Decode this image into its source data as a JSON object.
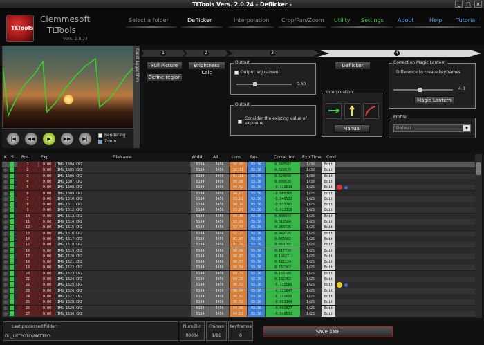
{
  "window": {
    "title": "TLTools Vers. 2.0.24 - Deflicker -",
    "min": "_",
    "max": "□",
    "close": "×"
  },
  "branding": {
    "company": "Ciemmesoft",
    "product": "TLTools",
    "version": "Vers. 2.0.24",
    "logo_text": "TLTools"
  },
  "nav": {
    "select_folder": "Select a folder",
    "deflicker": "Deflicker",
    "interpolation": "Interpolation",
    "crop": "Crop/Pan/Zoom",
    "utility": "Utility",
    "settings": "Settings",
    "about": "About",
    "help": "Help",
    "tutorial": "Tutorial"
  },
  "video": {
    "side_tab": "Crest Logarithm",
    "rendering_label": "Rendering",
    "zoom_label": "Zoom",
    "rendering_checked": false,
    "zoom_checked": true
  },
  "steps": {
    "s1": "1",
    "s2": "2",
    "s3": "3",
    "s4": "4"
  },
  "step1": {
    "full_picture": "Full Picture",
    "define_region": "Define region"
  },
  "step2": {
    "brightness_calc": "Brightness Calc"
  },
  "step3": {
    "output_title": "Output",
    "output_adjustment": "Output adjustment",
    "slider_value": "0.60",
    "slider_fraction": 0.3,
    "output2_title": "Output",
    "consider_text": "Consider the existing value of exposure",
    "interp_title": "Interpolation",
    "manual": "Manual"
  },
  "step4": {
    "deflicker": "Deflicker",
    "magic_title": "Correction Magic Lantern",
    "difference_text": "Difference to create keyframes",
    "slider_value": "4.0",
    "slider_fraction": 0.42,
    "magic_button": "Magic Lantern",
    "profile_title": "Profile",
    "profile_value": "Default"
  },
  "table": {
    "headers": {
      "k": "K",
      "s": "S",
      "pos": "Pos.",
      "exp": "Exp.",
      "file": "FileName",
      "width": "Width",
      "alt": "Alt.",
      "lum": "Lum.",
      "res": "Res.",
      "corr": "Correction",
      "exptime": "Exp.Time",
      "cmd": "Cmd"
    },
    "edit_label": "Edit",
    "rows": [
      {
        "pos": "1",
        "exp": "0.00",
        "file": "IMG_1504.CR2",
        "width": "5184",
        "alt": "3456",
        "lum": "92.85",
        "res": "93.36",
        "corr": "0.560587",
        "time": "1/30"
      },
      {
        "pos": "2",
        "exp": "0.00",
        "file": "IMG_1505.CR2",
        "width": "5184",
        "alt": "3456",
        "lum": "92.11",
        "res": "93.36",
        "corr": "0.522676",
        "time": "1/30"
      },
      {
        "pos": "3",
        "exp": "0.00",
        "file": "IMG_1506.CR2",
        "width": "5184",
        "alt": "3456",
        "lum": "91.11",
        "res": "93.36",
        "corr": "0.524698",
        "time": "1/30"
      },
      {
        "pos": "4",
        "exp": "0.00",
        "file": "IMG_1507.CR2",
        "width": "5184",
        "alt": "3456",
        "lum": "90.88",
        "res": "93.36",
        "corr": "0.609636",
        "time": "1/30"
      },
      {
        "pos": "5",
        "exp": "0.00",
        "file": "IMG_1508.CR2",
        "width": "5184",
        "alt": "3456",
        "lum": "94.02",
        "res": "93.36",
        "corr": "-0.111519",
        "time": "1/25",
        "marker": "red"
      },
      {
        "pos": "6",
        "exp": "0.00",
        "file": "IMG_1509.CR2",
        "width": "5184",
        "alt": "3456",
        "lum": "94.07",
        "res": "93.36",
        "corr": "-0.080365",
        "time": "1/25"
      },
      {
        "pos": "7",
        "exp": "0.00",
        "file": "IMG_1510.CR2",
        "width": "5184",
        "alt": "3456",
        "lum": "93.81",
        "res": "93.36",
        "corr": "-0.049532",
        "time": "1/25"
      },
      {
        "pos": "8",
        "exp": "0.00",
        "file": "IMG_1511.CR2",
        "width": "5184",
        "alt": "3456",
        "lum": "94.19",
        "res": "93.36",
        "corr": "-0.035702",
        "time": "1/25"
      },
      {
        "pos": "9",
        "exp": "0.00",
        "file": "IMG_1512.CR2",
        "width": "5184",
        "alt": "3456",
        "lum": "93.67",
        "res": "93.36",
        "corr": "-0.011318",
        "time": "1/25"
      },
      {
        "pos": "10",
        "exp": "0.00",
        "file": "IMG_1513.CR2",
        "width": "5184",
        "alt": "3456",
        "lum": "93.16",
        "res": "93.36",
        "corr": "0.008034",
        "time": "1/25"
      },
      {
        "pos": "11",
        "exp": "0.00",
        "file": "IMG_1514.CR2",
        "width": "5184",
        "alt": "3456",
        "lum": "93.09",
        "res": "93.36",
        "corr": "0.010584",
        "time": "1/25"
      },
      {
        "pos": "12",
        "exp": "0.00",
        "file": "IMG_1515.CR2",
        "width": "5184",
        "alt": "3456",
        "lum": "92.44",
        "res": "93.36",
        "corr": "0.030725",
        "time": "1/25"
      },
      {
        "pos": "13",
        "exp": "0.00",
        "file": "IMG_1516.CR2",
        "width": "5184",
        "alt": "3456",
        "lum": "92.23",
        "res": "93.36",
        "corr": "0.049725",
        "time": "1/25"
      },
      {
        "pos": "14",
        "exp": "0.00",
        "file": "IMG_1517.CR2",
        "width": "5184",
        "alt": "3456",
        "lum": "91.87",
        "res": "93.36",
        "corr": "0.063982",
        "time": "1/25"
      },
      {
        "pos": "15",
        "exp": "0.00",
        "file": "IMG_1518.CR2",
        "width": "5184",
        "alt": "3456",
        "lum": "91.76",
        "res": "93.36",
        "corr": "0.068765",
        "time": "1/25"
      },
      {
        "pos": "16",
        "exp": "0.00",
        "file": "IMG_1519.CR2",
        "width": "5184",
        "alt": "3456",
        "lum": "90.66",
        "res": "93.36",
        "corr": "0.117730",
        "time": "1/25"
      },
      {
        "pos": "17",
        "exp": "0.00",
        "file": "IMG_1520.CR2",
        "width": "5184",
        "alt": "3456",
        "lum": "90.87",
        "res": "93.36",
        "corr": "0.108271",
        "time": "1/25"
      },
      {
        "pos": "18",
        "exp": "0.00",
        "file": "IMG_1521.CR2",
        "width": "5184",
        "alt": "3456",
        "lum": "90.57",
        "res": "93.36",
        "corr": "0.122134",
        "time": "1/25"
      },
      {
        "pos": "19",
        "exp": "0.00",
        "file": "IMG_1522.CR2",
        "width": "5184",
        "alt": "3456",
        "lum": "90.54",
        "res": "93.36",
        "corr": "0.132362",
        "time": "1/25"
      },
      {
        "pos": "20",
        "exp": "0.00",
        "file": "IMG_1523.CR2",
        "width": "5184",
        "alt": "3456",
        "lum": "89.75",
        "res": "93.36",
        "corr": "0.155180",
        "time": "1/25"
      },
      {
        "pos": "21",
        "exp": "0.00",
        "file": "IMG_1524.CR2",
        "width": "5184",
        "alt": "3456",
        "lum": "89.29",
        "res": "93.36",
        "corr": "0.182362",
        "time": "1/25"
      },
      {
        "pos": "22",
        "exp": "0.00",
        "file": "IMG_1525.CR2",
        "width": "5184",
        "alt": "3456",
        "lum": "96.53",
        "res": "93.36",
        "corr": "-0.135589",
        "time": "1/25",
        "marker": "yellow"
      },
      {
        "pos": "23",
        "exp": "0.00",
        "file": "IMG_1526.CR2",
        "width": "5184",
        "alt": "3456",
        "lum": "96.04",
        "res": "93.36",
        "corr": "-0.121847",
        "time": "1/25"
      },
      {
        "pos": "24",
        "exp": "0.00",
        "file": "IMG_1527.CR2",
        "width": "5184",
        "alt": "3456",
        "lum": "95.82",
        "res": "93.36",
        "corr": "-0.102636",
        "time": "1/25"
      },
      {
        "pos": "25",
        "exp": "0.00",
        "file": "IMG_1528.CR2",
        "width": "5184",
        "alt": "3456",
        "lum": "95.53",
        "res": "93.36",
        "corr": "-0.091304",
        "time": "1/25"
      },
      {
        "pos": "26",
        "exp": "0.00",
        "file": "IMG_1529.CR2",
        "width": "5184",
        "alt": "3456",
        "lum": "94.86",
        "res": "93.36",
        "corr": "-0.093827",
        "time": "1/25"
      },
      {
        "pos": "27",
        "exp": "0.00",
        "file": "IMG_1530.CR2",
        "width": "5184",
        "alt": "3456",
        "lum": "94.01",
        "res": "93.36",
        "corr": "-0.049532",
        "time": "1/25"
      }
    ]
  },
  "footer": {
    "last_label": "Last processed folder:",
    "last_value": "D:\\_LRTPOTO\\MATTEO",
    "numdir_label": "Num.Dir.",
    "numdir_value": "00004",
    "frames_label": "Frames",
    "frames_value": "1/81",
    "keyframes_label": "Keyframes",
    "keyframes_value": "0",
    "save_xmp": "Save XMP"
  },
  "colors": {
    "lum": "#d9813a",
    "res": "#3b7fd9",
    "corr": "#39b84a",
    "accent_green": "#59c459",
    "accent_blue": "#5aa0e8"
  }
}
